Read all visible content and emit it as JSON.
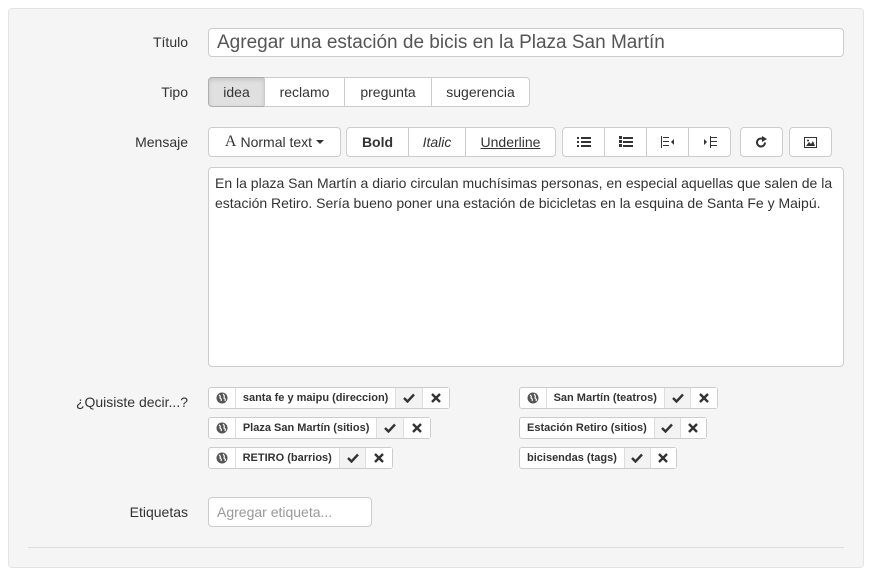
{
  "form": {
    "titulo_label": "Título",
    "titulo_value": "Agregar una estación de bicis en la Plaza San Martín",
    "tipo_label": "Tipo",
    "tipo_options": [
      "idea",
      "reclamo",
      "pregunta",
      "sugerencia"
    ],
    "tipo_selected": "idea",
    "mensaje_label": "Mensaje",
    "toolbar": {
      "font_glyph": "A",
      "font_label": "Normal text",
      "bold": "Bold",
      "italic": "Italic",
      "underline": "Underline",
      "icons": [
        "unordered-list-icon",
        "ordered-list-icon",
        "outdent-icon",
        "indent-icon",
        "redo-icon",
        "image-icon"
      ]
    },
    "mensaje_value": "En la plaza San Martín a diario circulan muchísimas personas, en especial aquellas que salen de la estación Retiro. Sería bueno poner una estación de bicicletas en la esquina de Santa Fe y Maipú.",
    "sugerencias_label": "¿Quisiste decir...?",
    "sugerencias": [
      {
        "text": "santa fe y maipu (direccion)",
        "globe": true
      },
      {
        "text": "San Martín (teatros)",
        "globe": true
      },
      {
        "text": "Plaza San Martín (sitios)",
        "globe": true
      },
      {
        "text": "Estación Retiro (sitios)",
        "globe": false
      },
      {
        "text": "RETIRO (barrios)",
        "globe": true
      },
      {
        "text": "bicisendas (tags)",
        "globe": false
      }
    ],
    "etiquetas_label": "Etiquetas",
    "etiquetas_placeholder": "Agregar etiqueta..."
  }
}
